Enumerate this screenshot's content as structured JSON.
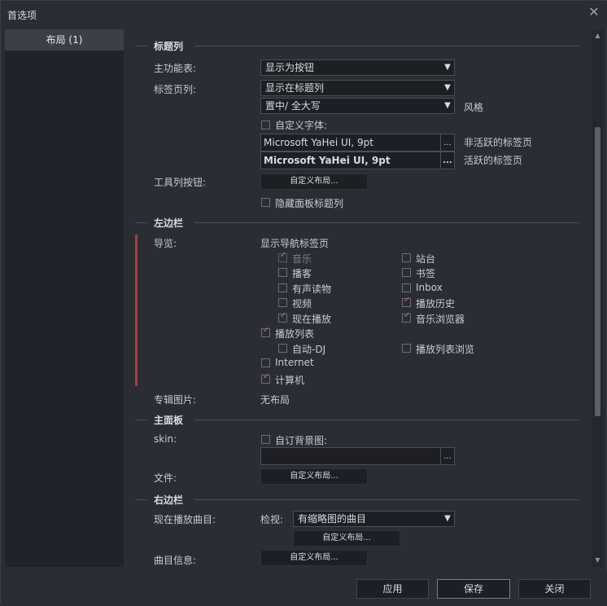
{
  "window": {
    "title": "首选项"
  },
  "sidebar": {
    "items": [
      {
        "label": "布局 (1)"
      }
    ]
  },
  "sections": {
    "titlebar": {
      "heading": "标题列",
      "main_menu_label": "主功能表:",
      "main_menu_value": "显示为按钮",
      "tab_label": "标签页列:",
      "tab_value": "显示在标题列",
      "tab_style_value": "置中/  全大写",
      "tab_style_label": "风格",
      "custom_font_label": "自定义字体:",
      "inactive_font": "Microsoft YaHei UI, 9pt",
      "inactive_label": "非活跃的标签页",
      "active_font": "Microsoft YaHei UI, 9pt",
      "active_label": "活跃的标签页",
      "toolbar_label": "工具列按钮:",
      "custom_layout_btn": "自定义布局...",
      "hide_panel_title": "隐藏面板标题列"
    },
    "left_sidebar": {
      "heading": "左边栏",
      "nav_label": "导览:",
      "nav_value": "显示导航标签页",
      "items": {
        "music": "音乐",
        "podcast": "播客",
        "audiobook": "有声读物",
        "video": "视频",
        "now_playing": "现在播放",
        "playlist": "播放列表",
        "auto_dj": "自动-DJ",
        "internet": "Internet",
        "computer": "计算机",
        "station": "站台",
        "bookmark": "书签",
        "inbox": "Inbox",
        "history": "播放历史",
        "music_browser": "音乐浏览器",
        "playlist_browser": "播放列表浏览"
      },
      "album_art_label": "专辑图片:",
      "album_art_value": "无布局"
    },
    "main_panel": {
      "heading": "主面板",
      "skin_label": "skin:",
      "custom_bg_label": "自订背景图:",
      "file_label": "文件:",
      "custom_layout_btn": "自定义布局..."
    },
    "right_sidebar": {
      "heading": "右边栏",
      "now_playing_label": "现在播放曲目:",
      "view_label": "检视:",
      "view_value": "有缩略图的曲目",
      "custom_layout_btn": "自定义布局...",
      "track_info_label": "曲目信息:",
      "custom_layout_btn2": "自定义布局..."
    }
  },
  "footer": {
    "apply": "应用",
    "save": "保存",
    "close": "关闭"
  },
  "icons": {
    "dots": "...",
    "arrow": "▼"
  },
  "colors": {
    "accent_red": "#b03a3a",
    "check_red": "#e05a5a"
  }
}
